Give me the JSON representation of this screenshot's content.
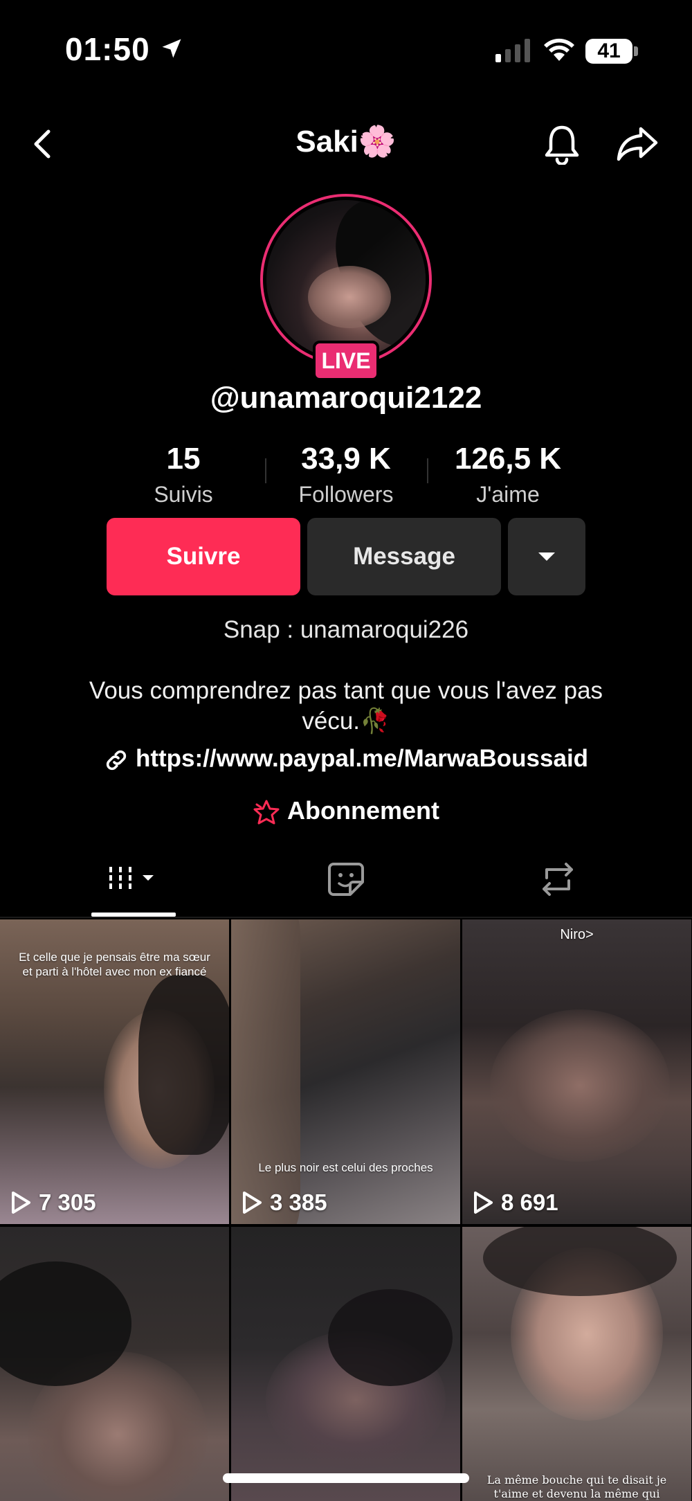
{
  "status_bar": {
    "time": "01:50",
    "battery": "41"
  },
  "header": {
    "title": "Saki🌸"
  },
  "profile": {
    "live_badge": "LIVE",
    "username": "@unamaroqui2122",
    "stats": [
      {
        "value": "15",
        "label": "Suivis"
      },
      {
        "value": "33,9 K",
        "label": "Followers"
      },
      {
        "value": "126,5 K",
        "label": "J'aime"
      }
    ],
    "buttons": {
      "follow": "Suivre",
      "message": "Message"
    },
    "snap": "Snap : unamaroqui226",
    "bio_line1": "Vous comprendrez pas tant que vous l'avez pas",
    "bio_line2": "vécu.🥀",
    "link": "https://www.paypal.me/MarwaBoussaid",
    "subscription": "Abonnement"
  },
  "videos": [
    {
      "caption": "Et celle que je pensais être ma sœur et parti à l'hôtel avec mon ex fiancé",
      "views": "7 305"
    },
    {
      "caption": "Le plus noir est celui des proches",
      "views": "3 385"
    },
    {
      "caption": "Niro>",
      "views": "8 691"
    },
    {
      "caption": "",
      "views": ""
    },
    {
      "caption": "",
      "views": ""
    },
    {
      "caption": "La même bouche qui te disait je t'aime et devenu la même qui t'insulte",
      "views": ""
    }
  ],
  "colors": {
    "accent": "#fe2c55",
    "live": "#ea2d72",
    "button_dark": "#2a2a2a"
  }
}
